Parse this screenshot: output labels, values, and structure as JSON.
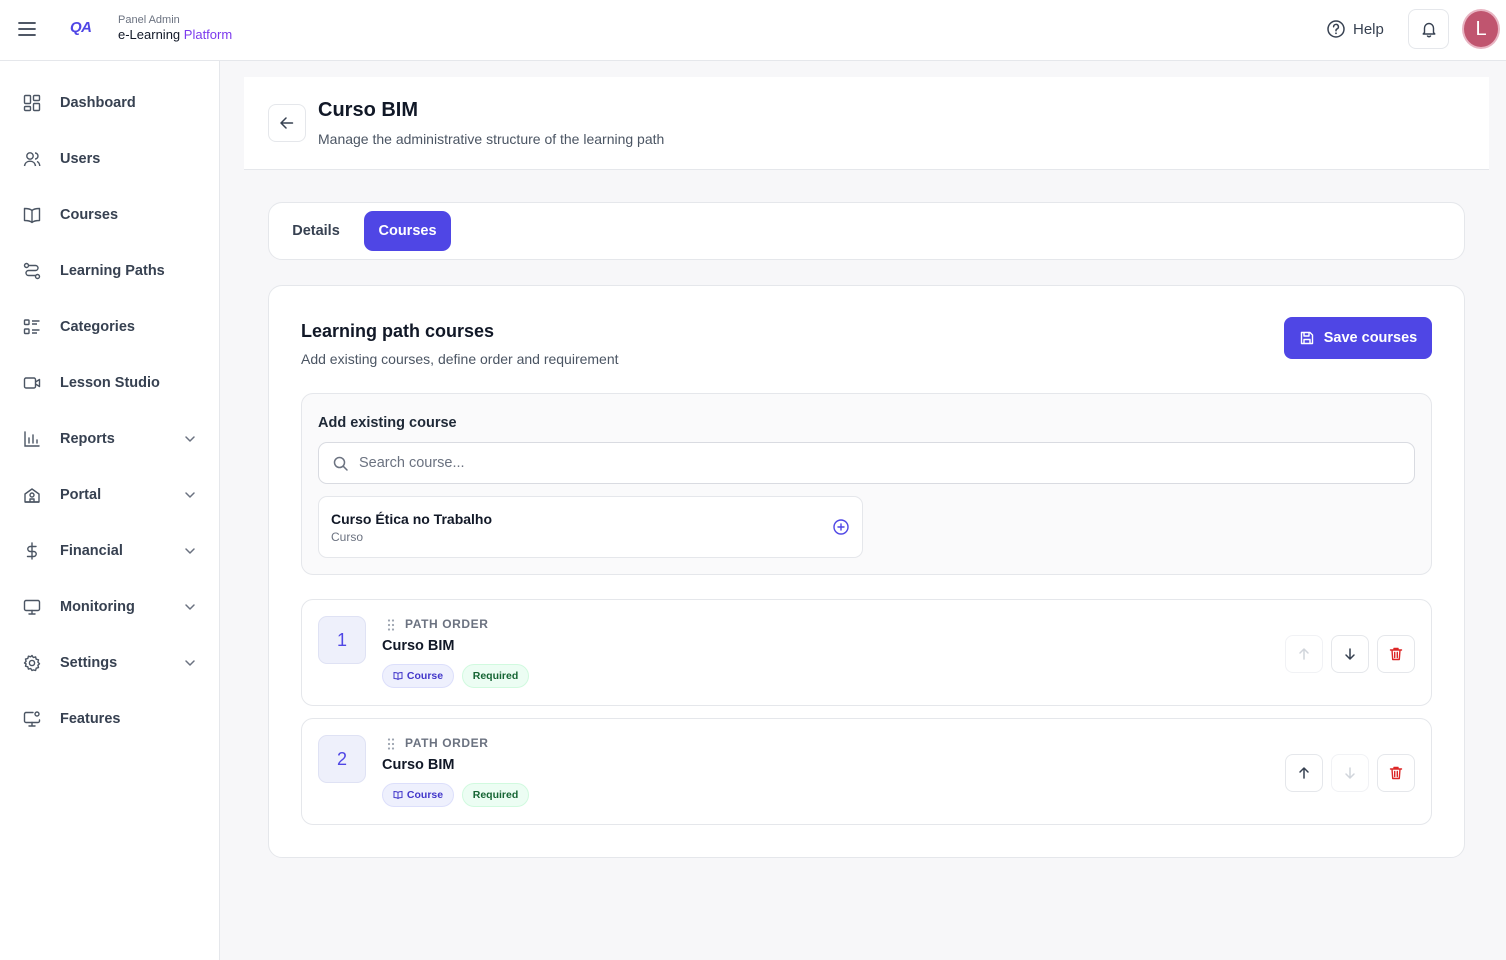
{
  "header": {
    "logo_text": "QA",
    "panel_label": "Panel Admin",
    "platform_prefix": "e-Learning",
    "platform_suffix": "Platform",
    "help_label": "Help",
    "avatar_initial": "L",
    "icons": [
      "menu-icon",
      "help-icon",
      "bell-icon"
    ],
    "colors": {
      "brand": "#4f46e5",
      "platform_accent": "#7c3aed",
      "avatar": "#c0556f"
    }
  },
  "sidebar": {
    "items": [
      {
        "label": "Dashboard",
        "icon": "dashboard-icon",
        "expandable": false
      },
      {
        "label": "Users",
        "icon": "users-icon",
        "expandable": false
      },
      {
        "label": "Courses",
        "icon": "book-icon",
        "expandable": false
      },
      {
        "label": "Learning Paths",
        "icon": "route-icon",
        "expandable": false
      },
      {
        "label": "Categories",
        "icon": "list-icon",
        "expandable": false
      },
      {
        "label": "Lesson Studio",
        "icon": "video-icon",
        "expandable": false
      },
      {
        "label": "Reports",
        "icon": "bar-chart-icon",
        "expandable": true
      },
      {
        "label": "Portal",
        "icon": "school-icon",
        "expandable": true
      },
      {
        "label": "Financial",
        "icon": "dollar-icon",
        "expandable": true
      },
      {
        "label": "Monitoring",
        "icon": "monitor-icon",
        "expandable": true
      },
      {
        "label": "Settings",
        "icon": "gear-icon",
        "expandable": true
      },
      {
        "label": "Features",
        "icon": "screen-settings-icon",
        "expandable": false
      }
    ]
  },
  "page": {
    "title": "Curso BIM",
    "subtitle": "Manage the administrative structure of the learning path"
  },
  "tabs": [
    {
      "label": "Details",
      "active": false
    },
    {
      "label": "Courses",
      "active": true
    }
  ],
  "courses_section": {
    "title": "Learning path courses",
    "subtitle": "Add existing courses, define order and requirement",
    "save_label": "Save courses",
    "add_box": {
      "title": "Add existing course",
      "search_placeholder": "Search course...",
      "search_value": "",
      "results": [
        {
          "name": "Curso Ética no Trabalho",
          "type": "Curso"
        }
      ]
    },
    "path_items": [
      {
        "order": "1",
        "label": "PATH ORDER",
        "name": "Curso BIM",
        "type_badge": "Course",
        "requirement_badge": "Required",
        "can_move_up": false,
        "can_move_down": true
      },
      {
        "order": "2",
        "label": "PATH ORDER",
        "name": "Curso BIM",
        "type_badge": "Course",
        "requirement_badge": "Required",
        "can_move_up": true,
        "can_move_down": false
      }
    ]
  },
  "colors": {
    "primary": "#4f46e5",
    "danger": "#dc2626",
    "success_badge_text": "#166534"
  }
}
